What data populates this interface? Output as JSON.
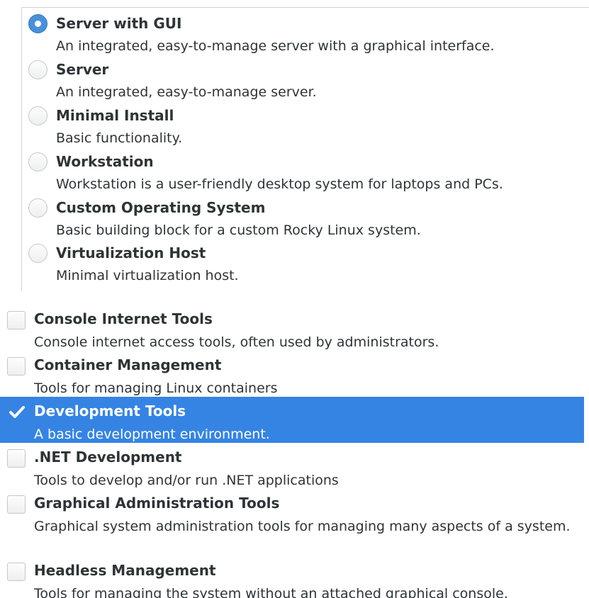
{
  "environments": [
    {
      "title": "Server with GUI",
      "description": "An integrated, easy-to-manage server with a graphical interface.",
      "selected": true
    },
    {
      "title": "Server",
      "description": "An integrated, easy-to-manage server.",
      "selected": false
    },
    {
      "title": "Minimal Install",
      "description": "Basic functionality.",
      "selected": false
    },
    {
      "title": "Workstation",
      "description": "Workstation is a user-friendly desktop system for laptops and PCs.",
      "selected": false
    },
    {
      "title": "Custom Operating System",
      "description": "Basic building block for a custom Rocky Linux system.",
      "selected": false
    },
    {
      "title": "Virtualization Host",
      "description": "Minimal virtualization host.",
      "selected": false
    }
  ],
  "addons": [
    {
      "title": "Console Internet Tools",
      "description": "Console internet access tools, often used by administrators.",
      "checked": false
    },
    {
      "title": "Container Management",
      "description": "Tools for managing Linux containers",
      "checked": false
    },
    {
      "title": "Development Tools",
      "description": "A basic development environment.",
      "checked": true
    },
    {
      "title": ".NET Development",
      "description": "Tools to develop and/or run .NET applications",
      "checked": false
    },
    {
      "title": "Graphical Administration Tools",
      "description": "Graphical system administration tools for managing many aspects of a system.",
      "checked": false
    },
    {
      "title": "Headless Management",
      "description": "Tools for managing the system without an attached graphical console.",
      "checked": false
    }
  ],
  "colors": {
    "selection": "#3584e4",
    "radio_checked": "#4a90d9",
    "text": "#2e3436"
  },
  "icons": {
    "radio_selected": "radio-selected-icon",
    "radio_unselected": "radio-unselected-icon",
    "checkbox_checked": "checkmark-icon",
    "checkbox_unchecked": "checkbox-empty-icon"
  }
}
